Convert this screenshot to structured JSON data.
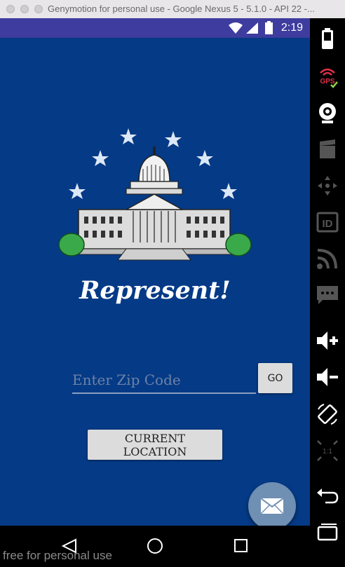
{
  "window": {
    "title": "Genymotion for personal use - Google Nexus 5 - 5.1.0 - API 22 -..."
  },
  "status_bar": {
    "time": "2:19",
    "icons": [
      "wifi-icon",
      "signal-icon",
      "battery-icon"
    ]
  },
  "app": {
    "title": "Represent!",
    "zip": {
      "placeholder": "Enter Zip Code",
      "value": ""
    },
    "go_label": "GO",
    "current_location_label": "CURRENT LOCATION",
    "fab_icon": "mail-icon",
    "brand_color": "#053a86"
  },
  "nav_bar": {
    "icons": [
      "back-icon",
      "home-icon",
      "recents-icon"
    ]
  },
  "watermark": "free for personal use",
  "sidebar_tools": [
    "battery-icon",
    "gps-icon",
    "webcam-icon",
    "screencast-icon",
    "dpad-icon",
    "device-id-icon",
    "network-icon",
    "sms-icon",
    "volume-up-icon",
    "volume-down-icon",
    "rotate-icon",
    "pixel-perfect-icon",
    "back-icon",
    "recents-icon"
  ]
}
